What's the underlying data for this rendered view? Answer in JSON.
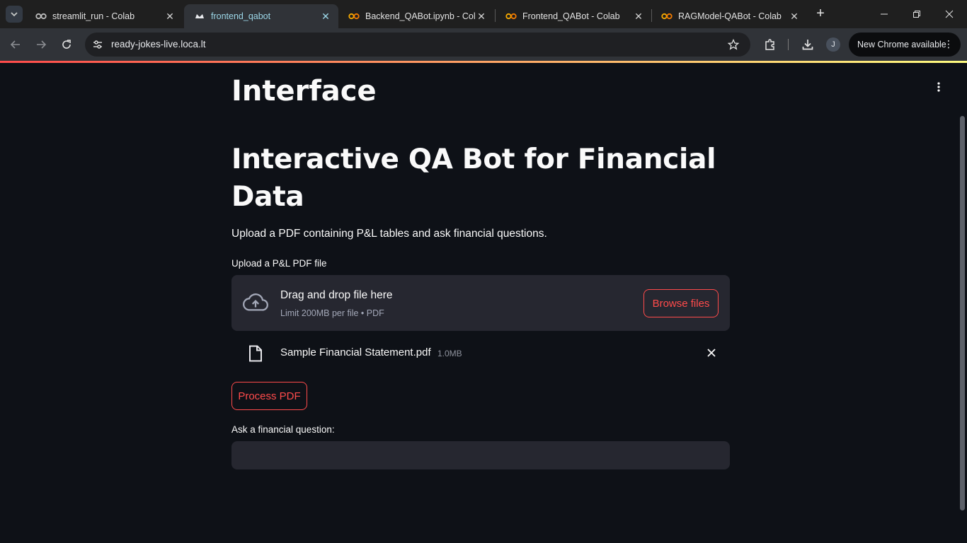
{
  "browser": {
    "tabs": [
      {
        "title": "streamlit_run - Colab",
        "icon": "colab-logo-gray",
        "active": false
      },
      {
        "title": "frontend_qabot",
        "icon": "streamlit-crown",
        "active": true
      },
      {
        "title": "Backend_QABot.ipynb - Cola",
        "icon": "colab-logo",
        "active": false
      },
      {
        "title": "Frontend_QABot - Colab",
        "icon": "colab-logo",
        "active": false
      },
      {
        "title": "RAGModel-QABot - Colab",
        "icon": "colab-logo",
        "active": false
      }
    ],
    "url": "ready-jokes-live.loca.lt",
    "profile_initial": "J",
    "update_label": "New Chrome available"
  },
  "page": {
    "clipped_heading": "Interface",
    "title": "Interactive QA Bot for Financial Data",
    "subtitle": "Upload a PDF containing P&L tables and ask financial questions.",
    "uploader": {
      "label": "Upload a P&L PDF file",
      "drop_text": "Drag and drop file here",
      "limit_text": "Limit 200MB per file • PDF",
      "browse_label": "Browse files"
    },
    "uploaded_file": {
      "name": "Sample Financial Statement.pdf",
      "size": "1.0MB"
    },
    "process_button": "Process PDF",
    "question": {
      "label": "Ask a financial question:",
      "value": "",
      "placeholder": ""
    }
  },
  "colors": {
    "accent": "#ff4b4b",
    "background": "#0e1117",
    "surface": "#262730",
    "text": "#fafafa"
  }
}
